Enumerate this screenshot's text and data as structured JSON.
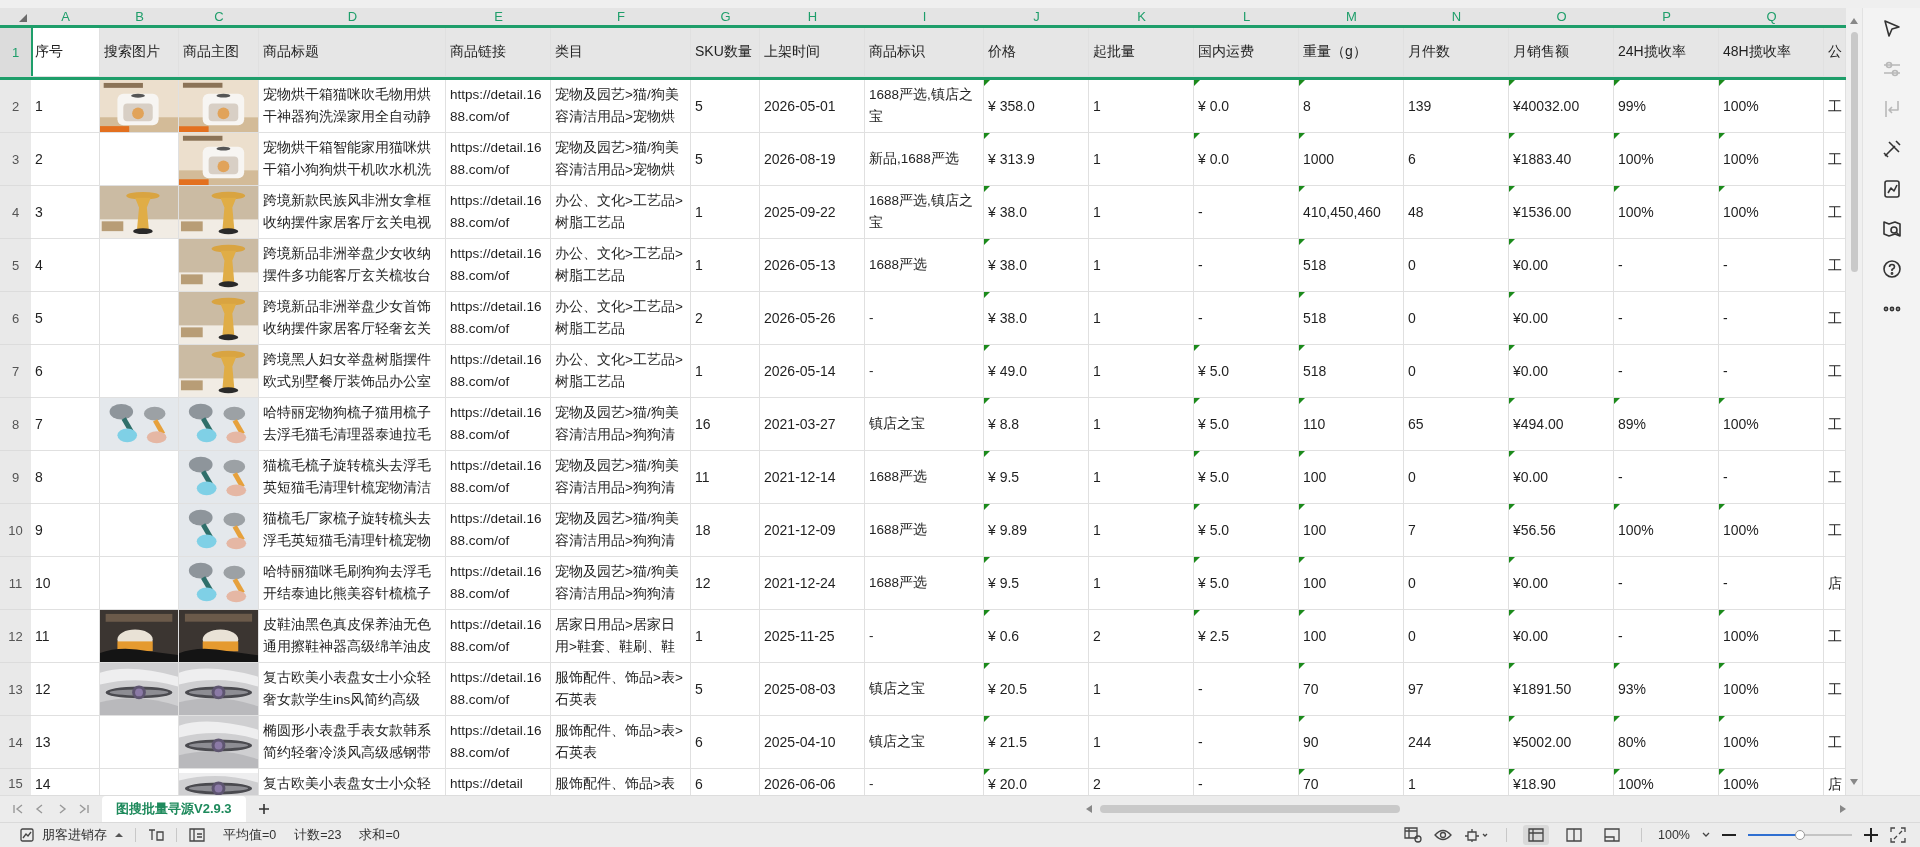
{
  "columns": [
    "A",
    "B",
    "C",
    "D",
    "E",
    "F",
    "G",
    "H",
    "I",
    "J",
    "K",
    "L",
    "M",
    "N",
    "O",
    "P",
    "Q"
  ],
  "header_row": {
    "number": "1",
    "selected": true,
    "cells": [
      {
        "text": "序号",
        "active": true
      },
      {
        "text": "搜索图片",
        "active": false
      },
      {
        "text": "商品主图",
        "active": false
      },
      {
        "text": "商品标题",
        "active": false
      },
      {
        "text": "商品链接",
        "active": false
      },
      {
        "text": "类目",
        "active": false
      },
      {
        "text": "SKU数量",
        "active": false
      },
      {
        "text": "上架时间",
        "active": false
      },
      {
        "text": "商品标识",
        "active": false
      },
      {
        "text": "价格",
        "active": false
      },
      {
        "text": "起批量",
        "active": false
      },
      {
        "text": "国内运费",
        "active": false
      },
      {
        "text": "重量（g）",
        "active": false
      },
      {
        "text": "月件数",
        "active": false
      },
      {
        "text": "月销售额",
        "active": false
      },
      {
        "text": "24H揽收率",
        "active": false
      },
      {
        "text": "48H揽收率",
        "active": false
      },
      {
        "text": "公",
        "active": false
      }
    ]
  },
  "rows": [
    {
      "number": "2",
      "partial": false,
      "index": "1",
      "title": "宠物烘干箱猫咪吹毛物用烘干神器狗洗澡家用全自动静",
      "link": "https://detail.1688.com/of",
      "category": "宠物及园艺>猫/狗美容清洁用品>宠物烘",
      "sku": "5",
      "listed": "2026-05-01",
      "tags": "1688严选,镇店之宝",
      "price": "¥ 358.0",
      "moq": "1",
      "shipping": "¥ 0.0",
      "weight": "8",
      "monthly_units": "139",
      "monthly_sales": "¥40032.00",
      "pickup_24h": "99%",
      "pickup_48h": "100%",
      "column_r": "工",
      "flags": {
        "price": true,
        "shipping": true,
        "weight": true,
        "monthly_sales": true,
        "pickup_24h": true,
        "pickup_48h": true
      }
    },
    {
      "number": "3",
      "partial": false,
      "index": "2",
      "title": "宠物烘干箱智能家用猫咪烘干箱小狗狗烘干机吹水机洗",
      "link": "https://detail.1688.com/of",
      "category": "宠物及园艺>猫/狗美容清洁用品>宠物烘",
      "sku": "5",
      "listed": "2026-08-19",
      "tags": "新品,1688严选",
      "price": "¥ 313.9",
      "moq": "1",
      "shipping": "¥ 0.0",
      "weight": "1000",
      "monthly_units": "6",
      "monthly_sales": "¥1883.40",
      "pickup_24h": "100%",
      "pickup_48h": "100%",
      "column_r": "工",
      "flags": {
        "price": true,
        "shipping": true,
        "weight": true,
        "monthly_sales": true,
        "pickup_24h": true,
        "pickup_48h": true
      }
    },
    {
      "number": "4",
      "partial": false,
      "index": "3",
      "title": "跨境新款民族风非洲女拿框收纳摆件家居客厅玄关电视",
      "link": "https://detail.1688.com/of",
      "category": "办公、文化>工艺品>树脂工艺品",
      "sku": "1",
      "listed": "2025-09-22",
      "tags": "1688严选,镇店之宝",
      "price": "¥ 38.0",
      "moq": "1",
      "shipping": "-",
      "weight": "410,450,460",
      "monthly_units": "48",
      "monthly_sales": "¥1536.00",
      "pickup_24h": "100%",
      "pickup_48h": "100%",
      "column_r": "工",
      "flags": {
        "price": true,
        "shipping": false,
        "weight": true,
        "monthly_sales": true,
        "pickup_24h": true,
        "pickup_48h": true
      }
    },
    {
      "number": "5",
      "partial": false,
      "index": "4",
      "title": "跨境新品非洲举盘少女收纳摆件多功能客厅玄关梳妆台",
      "link": "https://detail.1688.com/of",
      "category": "办公、文化>工艺品>树脂工艺品",
      "sku": "1",
      "listed": "2026-05-13",
      "tags": "1688严选",
      "price": "¥ 38.0",
      "moq": "1",
      "shipping": "-",
      "weight": "518",
      "monthly_units": "0",
      "monthly_sales": "¥0.00",
      "pickup_24h": "-",
      "pickup_48h": "-",
      "column_r": "工",
      "flags": {
        "price": true,
        "shipping": false,
        "weight": true,
        "monthly_sales": true,
        "pickup_24h": false,
        "pickup_48h": false
      }
    },
    {
      "number": "6",
      "partial": false,
      "index": "5",
      "title": "跨境新品非洲举盘少女首饰收纳摆件家居客厅轻奢玄关",
      "link": "https://detail.1688.com/of",
      "category": "办公、文化>工艺品>树脂工艺品",
      "sku": "2",
      "listed": "2026-05-26",
      "tags": "-",
      "price": "¥ 38.0",
      "moq": "1",
      "shipping": "-",
      "weight": "518",
      "monthly_units": "0",
      "monthly_sales": "¥0.00",
      "pickup_24h": "-",
      "pickup_48h": "-",
      "column_r": "工",
      "flags": {
        "price": true,
        "shipping": false,
        "weight": true,
        "monthly_sales": true,
        "pickup_24h": false,
        "pickup_48h": false
      }
    },
    {
      "number": "7",
      "partial": false,
      "index": "6",
      "title": "跨境黑人妇女举盘树脂摆件欧式别墅餐厅装饰品办公室",
      "link": "https://detail.1688.com/of",
      "category": "办公、文化>工艺品>树脂工艺品",
      "sku": "1",
      "listed": "2026-05-14",
      "tags": "-",
      "price": "¥ 49.0",
      "moq": "1",
      "shipping": "¥ 5.0",
      "weight": "518",
      "monthly_units": "0",
      "monthly_sales": "¥0.00",
      "pickup_24h": "-",
      "pickup_48h": "-",
      "column_r": "工",
      "flags": {
        "price": true,
        "shipping": true,
        "weight": true,
        "monthly_sales": true,
        "pickup_24h": false,
        "pickup_48h": false
      }
    },
    {
      "number": "8",
      "partial": false,
      "index": "7",
      "title": "哈特丽宠物狗梳子猫用梳子去浮毛猫毛清理器泰迪拉毛",
      "link": "https://detail.1688.com/of",
      "category": "宠物及园艺>猫/狗美容清洁用品>狗狗清",
      "sku": "16",
      "listed": "2021-03-27",
      "tags": "镇店之宝",
      "price": "¥ 8.8",
      "moq": "1",
      "shipping": "¥ 5.0",
      "weight": "110",
      "monthly_units": "65",
      "monthly_sales": "¥494.00",
      "pickup_24h": "89%",
      "pickup_48h": "100%",
      "column_r": "工",
      "flags": {
        "price": true,
        "shipping": true,
        "weight": true,
        "monthly_sales": true,
        "pickup_24h": true,
        "pickup_48h": true
      }
    },
    {
      "number": "9",
      "partial": false,
      "index": "8",
      "title": "猫梳毛梳子旋转梳头去浮毛英短猫毛清理针梳宠物清洁",
      "link": "https://detail.1688.com/of",
      "category": "宠物及园艺>猫/狗美容清洁用品>狗狗清",
      "sku": "11",
      "listed": "2021-12-14",
      "tags": "1688严选",
      "price": "¥ 9.5",
      "moq": "1",
      "shipping": "¥ 5.0",
      "weight": "100",
      "monthly_units": "0",
      "monthly_sales": "¥0.00",
      "pickup_24h": "-",
      "pickup_48h": "-",
      "column_r": "工",
      "flags": {
        "price": true,
        "shipping": true,
        "weight": true,
        "monthly_sales": true,
        "pickup_24h": false,
        "pickup_48h": false
      }
    },
    {
      "number": "10",
      "partial": false,
      "index": "9",
      "title": "猫梳毛厂家梳子旋转梳头去浮毛英短猫毛清理针梳宠物",
      "link": "https://detail.1688.com/of",
      "category": "宠物及园艺>猫/狗美容清洁用品>狗狗清",
      "sku": "18",
      "listed": "2021-12-09",
      "tags": "1688严选",
      "price": "¥ 9.89",
      "moq": "1",
      "shipping": "¥ 5.0",
      "weight": "100",
      "monthly_units": "7",
      "monthly_sales": "¥56.56",
      "pickup_24h": "100%",
      "pickup_48h": "100%",
      "column_r": "工",
      "flags": {
        "price": true,
        "shipping": true,
        "weight": true,
        "monthly_sales": true,
        "pickup_24h": true,
        "pickup_48h": true
      }
    },
    {
      "number": "11",
      "partial": false,
      "index": "10",
      "title": "哈特丽猫咪毛刷狗狗去浮毛开结泰迪比熊美容针梳梳子",
      "link": "https://detail.1688.com/of",
      "category": "宠物及园艺>猫/狗美容清洁用品>狗狗清",
      "sku": "12",
      "listed": "2021-12-24",
      "tags": "1688严选",
      "price": "¥ 9.5",
      "moq": "1",
      "shipping": "¥ 5.0",
      "weight": "100",
      "monthly_units": "0",
      "monthly_sales": "¥0.00",
      "pickup_24h": "-",
      "pickup_48h": "-",
      "column_r": "店",
      "flags": {
        "price": true,
        "shipping": true,
        "weight": true,
        "monthly_sales": true,
        "pickup_24h": false,
        "pickup_48h": false
      }
    },
    {
      "number": "12",
      "partial": false,
      "index": "11",
      "title": "皮鞋油黑色真皮保养油无色通用擦鞋神器高级绵羊油皮",
      "link": "https://detail.1688.com/of",
      "category": "居家日用品>居家日用>鞋套、鞋刷、鞋",
      "sku": "1",
      "listed": "2025-11-25",
      "tags": "-",
      "price": "¥ 0.6",
      "moq": "2",
      "shipping": "¥ 2.5",
      "weight": "100",
      "monthly_units": "0",
      "monthly_sales": "¥0.00",
      "pickup_24h": "-",
      "pickup_48h": "100%",
      "column_r": "工",
      "flags": {
        "price": true,
        "shipping": true,
        "weight": true,
        "monthly_sales": true,
        "pickup_24h": false,
        "pickup_48h": true
      }
    },
    {
      "number": "13",
      "partial": false,
      "index": "12",
      "title": "复古欧美小表盘女士小众轻奢女款学生ins风简约高级",
      "link": "https://detail.1688.com/of",
      "category": "服饰配件、饰品>表>石英表",
      "sku": "5",
      "listed": "2025-08-03",
      "tags": "镇店之宝",
      "price": "¥ 20.5",
      "moq": "1",
      "shipping": "-",
      "weight": "70",
      "monthly_units": "97",
      "monthly_sales": "¥1891.50",
      "pickup_24h": "93%",
      "pickup_48h": "100%",
      "column_r": "工",
      "flags": {
        "price": true,
        "shipping": false,
        "weight": true,
        "monthly_sales": true,
        "pickup_24h": true,
        "pickup_48h": true
      }
    },
    {
      "number": "14",
      "partial": false,
      "index": "13",
      "title": "椭圆形小表盘手表女款韩系简约轻奢冷淡风高级感钢带",
      "link": "https://detail.1688.com/of",
      "category": "服饰配件、饰品>表>石英表",
      "sku": "6",
      "listed": "2025-04-10",
      "tags": "镇店之宝",
      "price": "¥ 21.5",
      "moq": "1",
      "shipping": "-",
      "weight": "90",
      "monthly_units": "244",
      "monthly_sales": "¥5002.00",
      "pickup_24h": "80%",
      "pickup_48h": "100%",
      "column_r": "工",
      "flags": {
        "price": true,
        "shipping": false,
        "weight": true,
        "monthly_sales": true,
        "pickup_24h": true,
        "pickup_48h": true
      }
    },
    {
      "number": "15",
      "partial": true,
      "index": "14",
      "title": "复古欧美小表盘女士小众轻",
      "link": "https://detail",
      "category": "服饰配件、饰品>表",
      "sku": "6",
      "listed": "2026-06-06",
      "tags": "-",
      "price": "¥ 20.0",
      "moq": "2",
      "shipping": "-",
      "weight": "70",
      "monthly_units": "1",
      "monthly_sales": "¥18.90",
      "pickup_24h": "100%",
      "pickup_48h": "100%",
      "column_r": "店",
      "flags": {
        "price": true,
        "shipping": false,
        "weight": true,
        "monthly_sales": true,
        "pickup_24h": true,
        "pickup_48h": true
      }
    }
  ],
  "sheet_tabs": [
    {
      "label": "图搜批量寻源V2.9.3",
      "selected": true
    }
  ],
  "side_tools": [
    {
      "disabled": false
    },
    {
      "disabled": true
    },
    {
      "disabled": true
    },
    {
      "disabled": false
    },
    {
      "disabled": false
    },
    {
      "disabled": false
    },
    {
      "disabled": false
    },
    {
      "disabled": false
    }
  ],
  "status_bar": {
    "app_menu": "朋客进销存",
    "stats": [
      "平均值=0",
      "计数=23",
      "求和=0"
    ],
    "view_modes": [
      {
        "selected": true
      },
      {
        "selected": false
      },
      {
        "selected": false
      }
    ],
    "zoom": "100%",
    "zoom_slider": {
      "level": 0.5
    }
  }
}
